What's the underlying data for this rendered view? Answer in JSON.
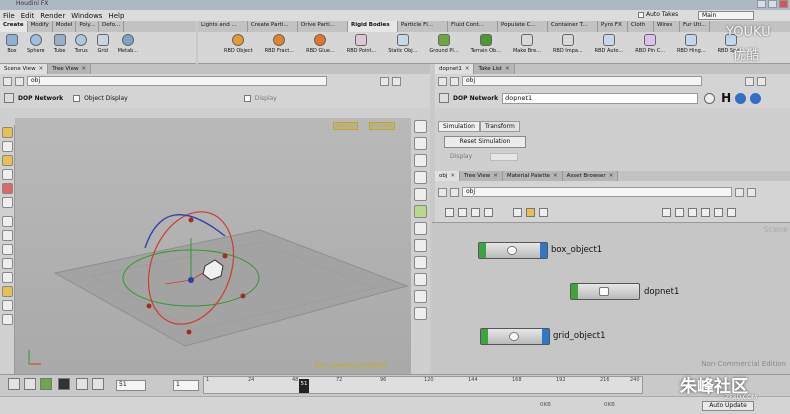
{
  "window": {
    "title": "Houdini FX"
  },
  "menu": [
    "File",
    "Edit",
    "Render",
    "Windows",
    "Help"
  ],
  "top_right": {
    "auto_takes": "Auto Takes",
    "desktop": "Main"
  },
  "shelf_left": {
    "tabs": [
      "Create",
      "Modify",
      "Model",
      "Poly...",
      "Defo..."
    ],
    "tools": [
      "Box",
      "Sphere",
      "Tube",
      "Torus",
      "Grid",
      "Metab..."
    ]
  },
  "shelf_right": {
    "tabs": [
      "Lights and ...",
      "Create Parti...",
      "Drive Parti...",
      "Rigid Bodies",
      "Particle Fl...",
      "Fluid Cont...",
      "Populate C...",
      "Container T...",
      "Pyro FX",
      "Cloth",
      "Wires",
      "Fur Uti..."
    ],
    "tools": [
      "RBD Object",
      "RBD Fract...",
      "RBD Glue...",
      "RBD Point...",
      "Static Obj...",
      "Ground Pl...",
      "Terrain Ob...",
      "Make Bre...",
      "RBD Impa...",
      "RBD Auto...",
      "RBD Pin C...",
      "RBD Hing...",
      "RBD Spri..."
    ]
  },
  "left_pane": {
    "tabs": [
      "Scene View",
      "Tree View"
    ],
    "path": "obj",
    "dop_label": "DOP Network",
    "object_display": "Object Display",
    "display": "Display",
    "camera_left": "persp1",
    "camera_right": "no cam",
    "watermark": "Non-Commercial Edition"
  },
  "right_pane": {
    "tabs": [
      "dopnet1",
      "Take List"
    ],
    "path": "obj",
    "dop_label": "DOP Network",
    "node_name": "dopnet1",
    "sim_tabs": [
      "Simulation",
      "Transform"
    ],
    "reset_button": "Reset Simulation",
    "display": "Display"
  },
  "network": {
    "tabs": [
      "obj",
      "Tree View",
      "Material Palette",
      "Asset Browser"
    ],
    "path": "obj",
    "scene_label": "Scene",
    "watermark": "Non-Commercial Edition",
    "nodes": [
      {
        "name": "box_object1"
      },
      {
        "name": "dopnet1"
      },
      {
        "name": "grid_object1"
      }
    ]
  },
  "playbar": {
    "frame": "51",
    "start": "1",
    "current_frame": "51",
    "ticks": [
      "1",
      "24",
      "48",
      "72",
      "96",
      "120",
      "144",
      "168",
      "192",
      "216",
      "240"
    ]
  },
  "status": {
    "auto_update": "Auto Update",
    "left_field": "0KB",
    "right_field": "0KB"
  },
  "watermarks": {
    "youku": "YOUKU",
    "youku_cn": "优酷",
    "site": "朱峰社区",
    "site_url": "ZF3D.COM"
  },
  "colors": {
    "node_left": "#3fa43f",
    "node_right": "#2f78c8",
    "camera_label": "#d4b300"
  }
}
